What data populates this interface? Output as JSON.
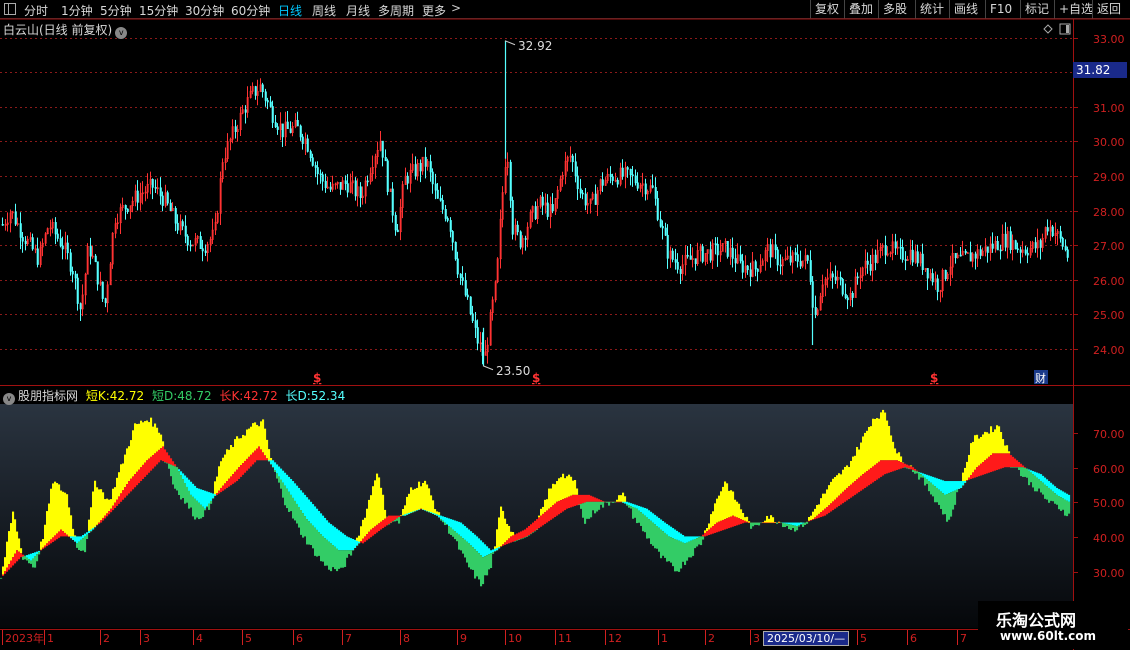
{
  "toolbar": {
    "tabs": [
      "分时",
      "1分钟",
      "5分钟",
      "15分钟",
      "30分钟",
      "60分钟",
      "日线",
      "周线",
      "月线",
      "多周期",
      "更多"
    ],
    "active_tab": "日线",
    "right_buttons": [
      "复权",
      "叠加",
      "多股",
      "统计",
      "画线",
      "F10",
      "标记",
      "+自选",
      "返回"
    ]
  },
  "main": {
    "title": "白云山(日线 前复权)",
    "current_price": "31.82",
    "high_label": "32.92",
    "low_label": "23.50",
    "markers": [
      "$",
      "$",
      "$",
      "财"
    ],
    "y_ticks": [
      "33.00",
      "32.00",
      "31.00",
      "30.00",
      "29.00",
      "28.00",
      "27.00",
      "26.00",
      "25.00",
      "24.00"
    ]
  },
  "indicator": {
    "name": "股朋指标网",
    "short_k_label": "短K:",
    "short_k": "42.72",
    "short_d_label": "短D:",
    "short_d": "48.72",
    "long_k_label": "长K:",
    "long_k": "42.72",
    "long_d_label": "长D:",
    "long_d": "52.34",
    "y_ticks": [
      "70.00",
      "60.00",
      "50.00",
      "40.00",
      "30.00"
    ]
  },
  "x_axis": {
    "labels": [
      "2023年",
      "1",
      "2",
      "3",
      "4",
      "5",
      "6",
      "7",
      "8",
      "9",
      "10",
      "11",
      "12",
      "1",
      "2",
      "3",
      "2025/03/10/—",
      "5",
      "6",
      "7"
    ]
  },
  "colors": {
    "up": "#ff3333",
    "down": "#55ffff",
    "yellow": "#ffff00",
    "red": "#ff1a1a",
    "green": "#33cc66",
    "cyan": "#00ffff",
    "grid": "#8a1a1a",
    "border": "#a01010"
  },
  "watermark": {
    "line1": "乐淘公式网",
    "line2": "www.60lt.com"
  }
}
